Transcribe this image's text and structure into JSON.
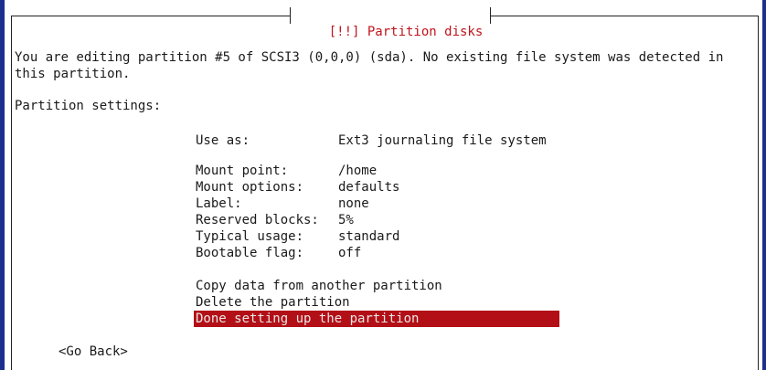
{
  "dialog": {
    "title": "[!!] Partition disks",
    "intro": "You are editing partition #5 of SCSI3 (0,0,0) (sda). No existing file system was detected in this partition.",
    "section_label": "Partition settings:"
  },
  "settings": {
    "use_as": {
      "label": "Use as:",
      "value": "Ext3 journaling file system"
    },
    "rows": [
      {
        "label": "Mount point:",
        "value": "/home"
      },
      {
        "label": "Mount options:",
        "value": "defaults"
      },
      {
        "label": "Label:",
        "value": "none"
      },
      {
        "label": "Reserved blocks:",
        "value": "5%"
      },
      {
        "label": "Typical usage:",
        "value": "standard"
      },
      {
        "label": "Bootable flag:",
        "value": "off"
      }
    ]
  },
  "actions": {
    "copy": "Copy data from another partition",
    "delete": "Delete the partition",
    "done": "Done setting up the partition"
  },
  "footer": {
    "go_back": "<Go Back>"
  },
  "colors": {
    "accent": "#b30f16",
    "title": "#c0141b",
    "screen_border": "#1c2f8f"
  }
}
